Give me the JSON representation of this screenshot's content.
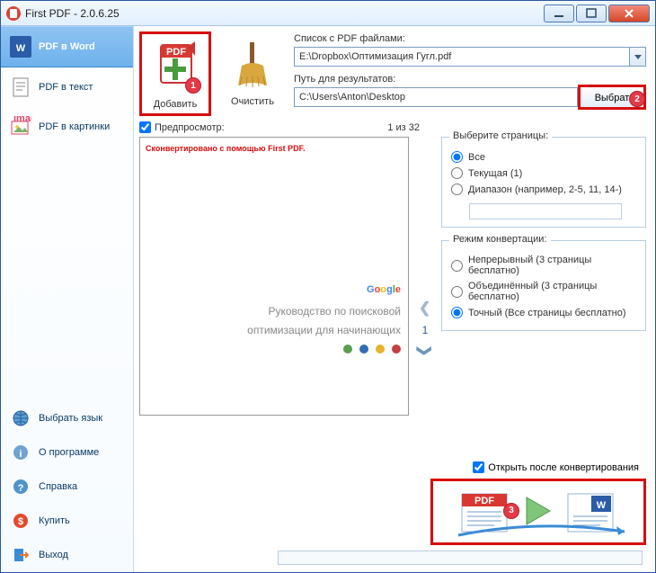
{
  "window": {
    "title": "First PDF - 2.0.6.25"
  },
  "sidebar": {
    "top": [
      {
        "label": "PDF в Word",
        "name": "pdf-to-word"
      },
      {
        "label": "PDF в текст",
        "name": "pdf-to-text"
      },
      {
        "label": "PDF в картинки",
        "name": "pdf-to-images"
      }
    ],
    "bottom": [
      {
        "label": "Выбрать язык",
        "name": "choose-language"
      },
      {
        "label": "О программе",
        "name": "about"
      },
      {
        "label": "Справка",
        "name": "help"
      },
      {
        "label": "Купить",
        "name": "buy"
      },
      {
        "label": "Выход",
        "name": "exit"
      }
    ]
  },
  "toolbar": {
    "add_label": "Добавить",
    "clear_label": "Очистить",
    "badges": {
      "add": "1",
      "choose": "2",
      "convert": "3"
    }
  },
  "files": {
    "list_label": "Список с PDF файлами:",
    "list_value": "E:\\Dropbox\\Оптимизация Гугл.pdf",
    "out_label": "Путь для результатов:",
    "out_value": "C:\\Users\\Anton\\Desktop",
    "choose_label": "Выбрать"
  },
  "preview": {
    "checkbox_label": "Предпросмотр:",
    "counter": "1 из 32",
    "watermark": "Сконвертировано с помощью First PDF.",
    "page_number": "1",
    "doc_title_line1": "Руководство по поисковой",
    "doc_title_line2": "оптимизации для начинающих",
    "dot_colors": [
      "#5b9e4d",
      "#2f6fb3",
      "#e6b32c",
      "#c43f3f"
    ]
  },
  "pages_group": {
    "title": "Выберите страницы:",
    "all": "Все",
    "current": "Текущая (1)",
    "range": "Диапазон (например, 2-5, 11, 14-)",
    "range_value": ""
  },
  "mode_group": {
    "title": "Режим конвертации:",
    "continuous": "Непрерывный (3 страницы бесплатно)",
    "combined": "Объединённый (3 страницы бесплатно)",
    "exact": "Точный (Все страницы бесплатно)"
  },
  "convert": {
    "open_after": "Открыть после конвертирования"
  }
}
